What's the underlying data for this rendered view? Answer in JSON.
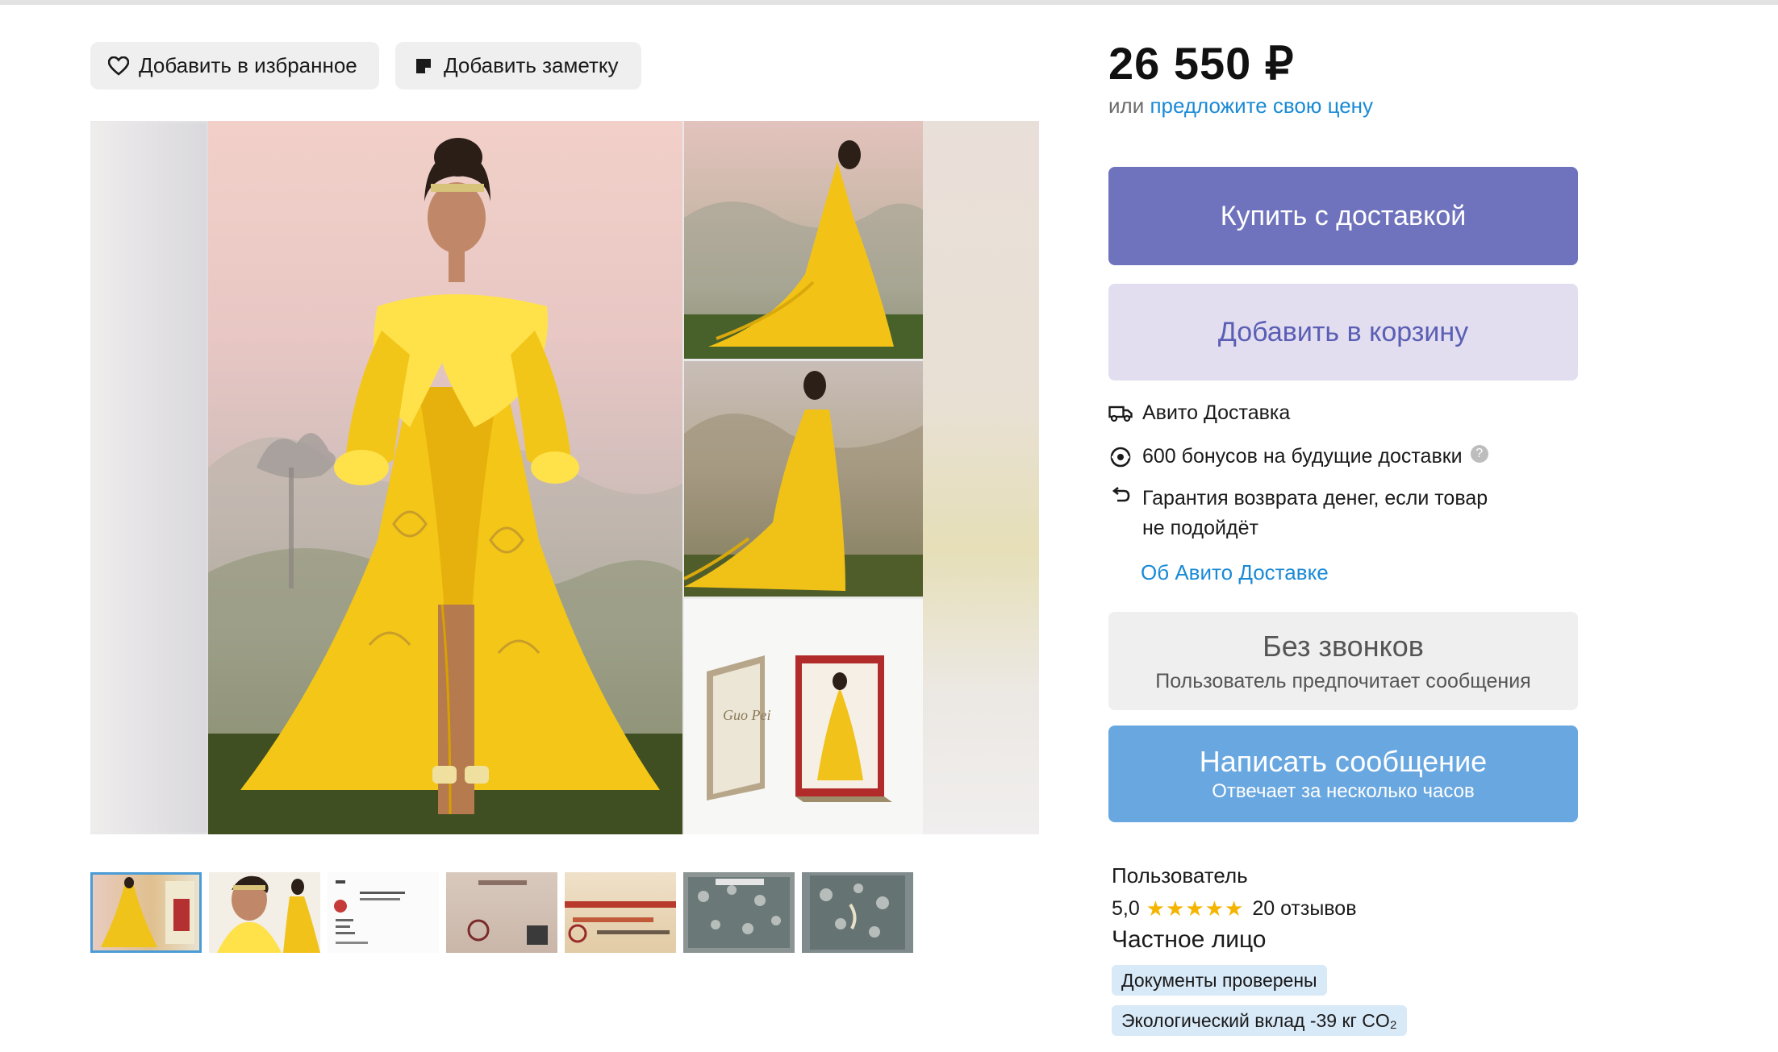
{
  "actions": {
    "favorite_label": "Добавить в избранное",
    "note_label": "Добавить заметку"
  },
  "price": {
    "amount": "26 550 ₽",
    "or_text": "или",
    "offer_link": "предложите свою цену"
  },
  "buttons": {
    "buy": "Купить с доставкой",
    "cart": "Добавить в корзину"
  },
  "delivery": {
    "service": "Авито Доставка",
    "bonus": "600 бонусов на будущие доставки",
    "help_icon": "?",
    "guarantee_line1": "Гарантия возврата денег, если товар",
    "guarantee_line2": "не подойдёт",
    "about_link": "Об Авито Доставке"
  },
  "contact": {
    "no_calls_title": "Без звонков",
    "no_calls_sub": "Пользователь предпочитает сообщения",
    "message_title": "Написать сообщение",
    "message_sub": "Отвечает за несколько часов"
  },
  "seller": {
    "label": "Пользователь",
    "rating": "5,0",
    "stars": "★★★★★",
    "reviews": "20 отзывов",
    "type": "Частное лицо",
    "badges": [
      "Документы проверены",
      "Экологический вклад -39 кг CO₂"
    ]
  },
  "gallery": {
    "thumbnail_count": 7,
    "selected_thumbnail": 1
  },
  "colors": {
    "buy_button": "#6f73bd",
    "cart_button": "#e2def0",
    "message_button": "#69a7e0",
    "link": "#1a8ad6",
    "star": "#f5b400",
    "badge": "#d8e9f8"
  },
  "icons": [
    "heart-icon",
    "note-icon",
    "truck-icon",
    "bonus-icon",
    "return-icon",
    "help-icon",
    "star-icon"
  ]
}
